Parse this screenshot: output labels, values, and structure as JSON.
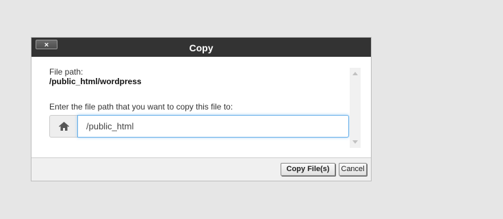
{
  "dialog": {
    "title": "Copy",
    "close_label": "×"
  },
  "form": {
    "file_path_label": "File path:",
    "file_path_value": "/public_html/wordpress",
    "destination_label": "Enter the file path that you want to copy this file to:",
    "destination_value": "/public_html",
    "addon_icon": "home-icon"
  },
  "footer": {
    "copy_label": "Copy File(s)",
    "cancel_label": "Cancel"
  },
  "colors": {
    "titlebar": "#333333",
    "focus_border": "#66afe9"
  }
}
